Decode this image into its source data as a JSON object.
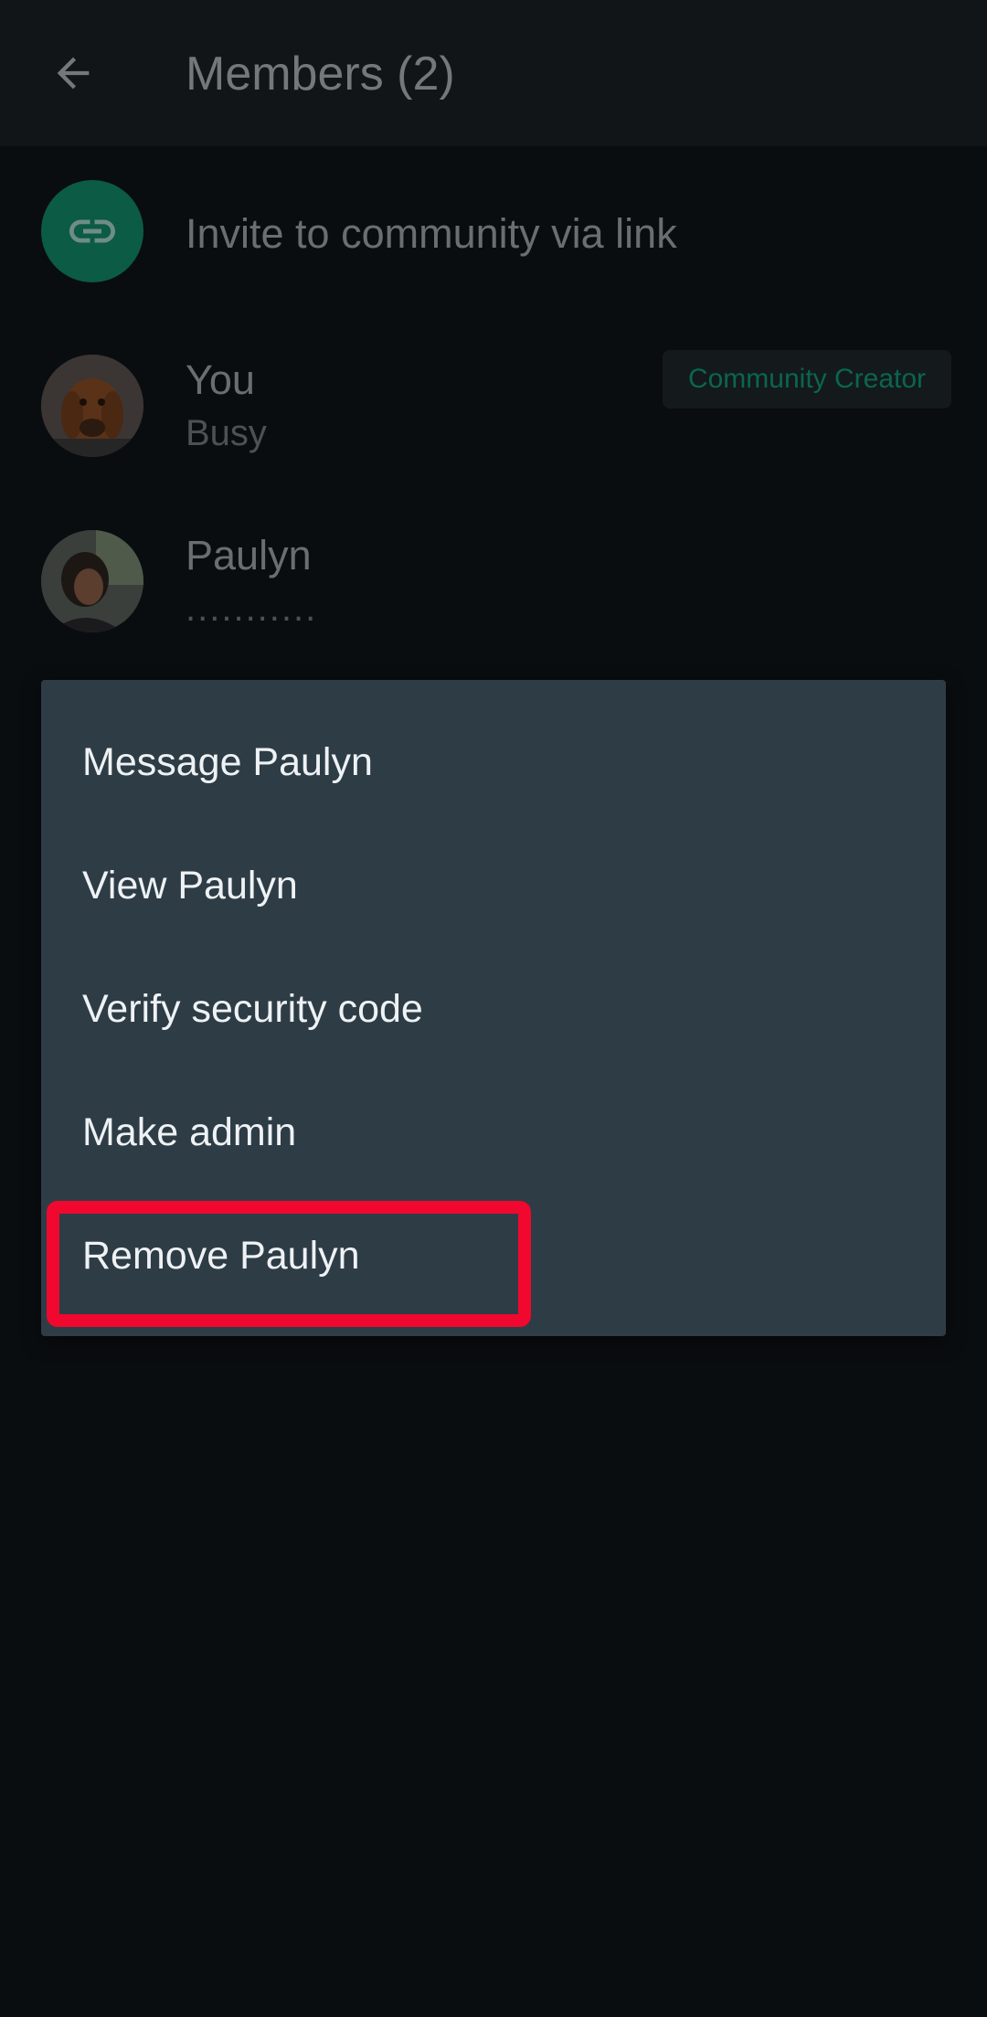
{
  "appbar": {
    "title": "Members (2)",
    "back_icon": "arrow-left-icon"
  },
  "invite": {
    "label": "Invite to community via link",
    "icon": "link-icon",
    "icon_bg": "#0b5b45"
  },
  "members": [
    {
      "name": "You",
      "status": "Busy",
      "badge": "Community Creator",
      "avatar": "dog-photo-avatar"
    },
    {
      "name": "Paulyn",
      "status": "...........",
      "avatar": "person-photo-avatar"
    }
  ],
  "context_menu": {
    "items": [
      "Message Paulyn",
      "View Paulyn",
      "Verify security code",
      "Make admin",
      "Remove Paulyn"
    ],
    "highlighted_item": "Remove Paulyn",
    "highlight_color": "#f0082f"
  },
  "colors": {
    "background": "#0a0d10",
    "menu_bg": "#2e3c46",
    "accent_green": "#0a6650"
  }
}
